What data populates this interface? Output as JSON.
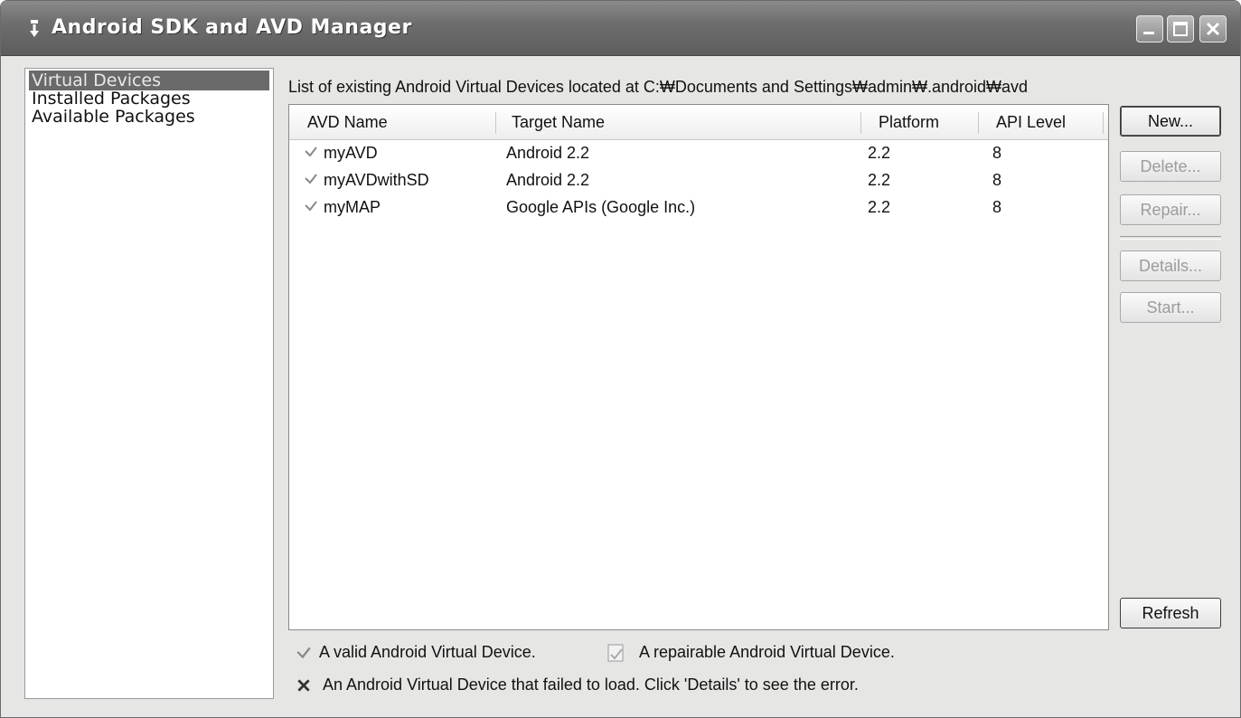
{
  "window": {
    "title": "Android SDK and AVD Manager"
  },
  "sidebar": {
    "items": [
      {
        "label": "Virtual Devices",
        "selected": true
      },
      {
        "label": "Installed Packages",
        "selected": false
      },
      {
        "label": "Available Packages",
        "selected": false
      }
    ]
  },
  "panel": {
    "label": "List of existing Android Virtual Devices located at C:₩Documents and Settings₩admin₩.android₩avd",
    "columns": [
      "AVD Name",
      "Target Name",
      "Platform",
      "API Level"
    ],
    "rows": [
      {
        "status_icon": "valid-check-icon",
        "name": "myAVD",
        "target": "Android 2.2",
        "platform": "2.2",
        "api": "8"
      },
      {
        "status_icon": "valid-check-icon",
        "name": "myAVDwithSD",
        "target": "Android 2.2",
        "platform": "2.2",
        "api": "8"
      },
      {
        "status_icon": "valid-check-icon",
        "name": "myMAP",
        "target": "Google APIs (Google Inc.)",
        "platform": "2.2",
        "api": "8"
      }
    ]
  },
  "buttons": {
    "new": "New...",
    "delete": "Delete...",
    "repair": "Repair...",
    "details": "Details...",
    "start": "Start...",
    "refresh": "Refresh"
  },
  "legend": {
    "valid": "A valid Android Virtual Device.",
    "repairable": "A repairable Android Virtual Device.",
    "failed": "An Android Virtual Device that failed to load. Click 'Details' to see the error."
  },
  "colors": {
    "titlebar": "#6e6e6e",
    "selection": "#6a6a6a",
    "disabled_text": "#9c9c9c"
  }
}
